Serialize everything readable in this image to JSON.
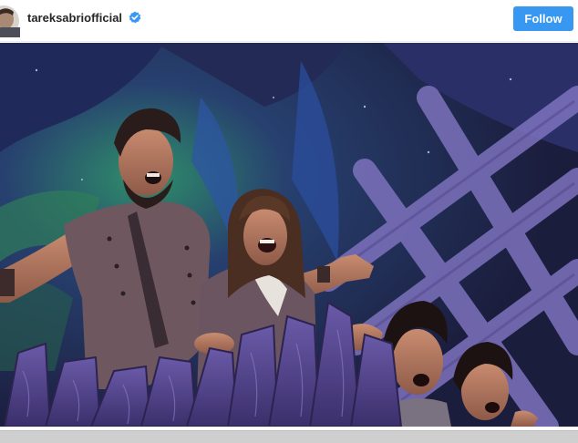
{
  "post_header": {
    "username": "tareksabriofficial",
    "verified_icon": "verified-badge-icon",
    "follow_label": "Follow",
    "accent_color": "#3897f0"
  },
  "photo": {
    "subject": "stage-performance-photo"
  }
}
